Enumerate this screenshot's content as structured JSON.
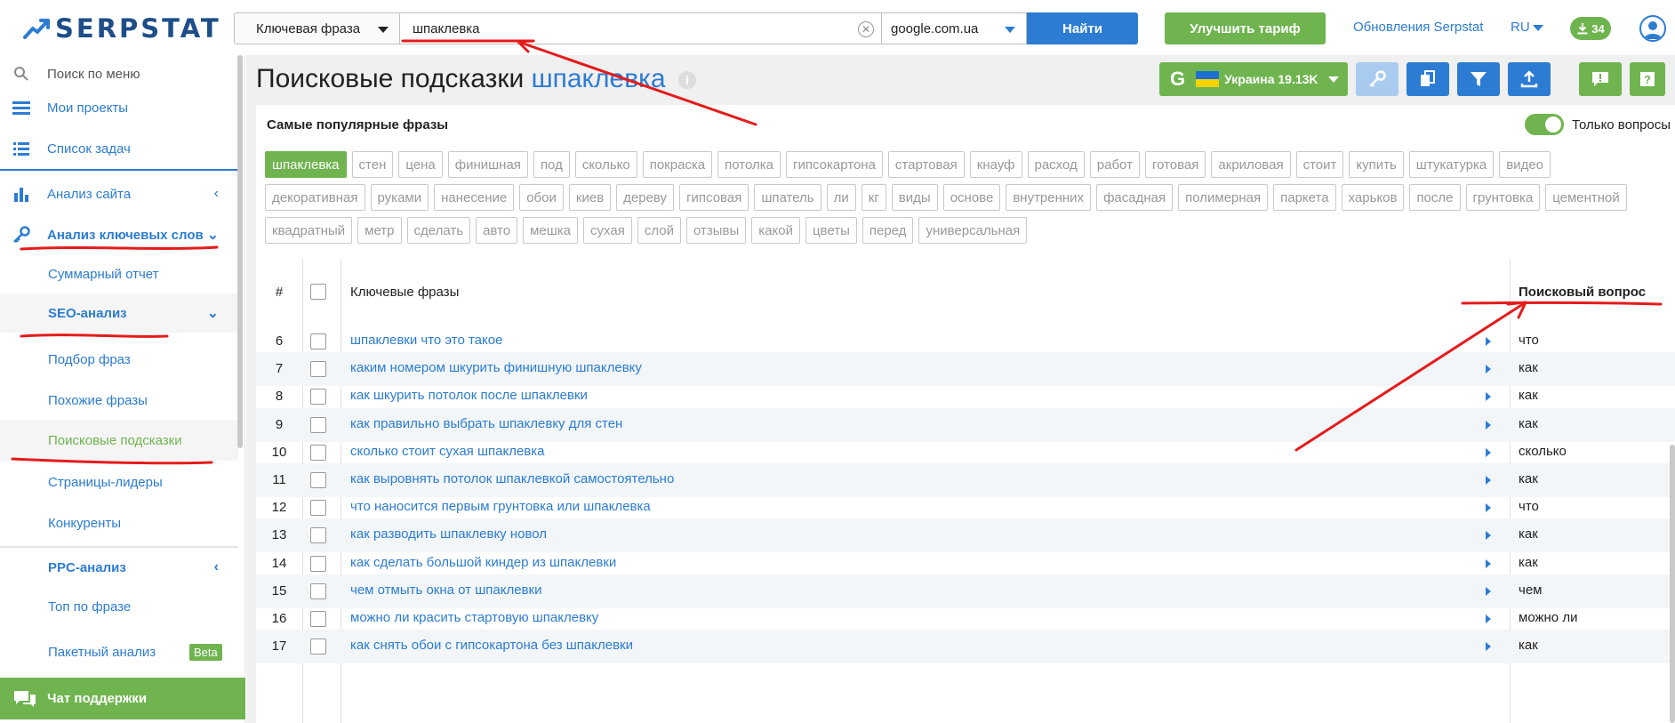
{
  "brand": {
    "name": "SERPSTAT"
  },
  "topbar": {
    "search_type": "Ключевая фраза",
    "search_value": "шпаклевка",
    "database": "google.com.ua",
    "find_label": "Найти",
    "upgrade_label": "Улучшить тариф",
    "updates_label": "Обновления Serpstat",
    "lang": "RU",
    "downloads_count": "34"
  },
  "sidebar": {
    "menu_search": "Поиск по меню",
    "my_projects": "Мои проекты",
    "task_list": "Список задач",
    "site_analysis": "Анализ сайта",
    "keyword_analysis": "Анализ ключевых слов",
    "summary_report": "Суммарный отчет",
    "seo_analysis": "SEO-анализ",
    "phrase_selection": "Подбор фраз",
    "similar_phrases": "Похожие фразы",
    "search_suggestions": "Поисковые подсказки",
    "leader_pages": "Страницы-лидеры",
    "competitors": "Конкуренты",
    "ppc_analysis": "PPC-анализ",
    "top_by_phrase": "Топ по фразе",
    "batch_analysis": "Пакетный анализ",
    "beta": "Beta",
    "support_chat": "Чат поддержки"
  },
  "page": {
    "title_prefix": "Поисковые подсказки",
    "title_keyword": "шпаклевка",
    "region_label": "Украина 19.13K"
  },
  "popular": {
    "title": "Самые популярные фразы",
    "only_questions": "Только вопросы",
    "tags": [
      "шпаклевка",
      "стен",
      "цена",
      "финишная",
      "под",
      "сколько",
      "покраска",
      "потолка",
      "гипсокартона",
      "стартовая",
      "кнауф",
      "расход",
      "работ",
      "готовая",
      "акриловая",
      "стоит",
      "купить",
      "штукатурка",
      "видео",
      "декоративная",
      "руками",
      "нанесение",
      "обои",
      "киев",
      "дереву",
      "гипсовая",
      "шпатель",
      "ли",
      "кг",
      "виды",
      "основе",
      "внутренних",
      "фасадная",
      "полимерная",
      "паркета",
      "харьков",
      "после",
      "грунтовка",
      "цементной",
      "квадратный",
      "метр",
      "сделать",
      "авто",
      "мешка",
      "сухая",
      "слой",
      "отзывы",
      "какой",
      "цветы",
      "перед",
      "универсальная"
    ]
  },
  "table": {
    "col_num": "#",
    "col_keywords": "Ключевые фразы",
    "col_question": "Поисковый вопрос",
    "rows": [
      {
        "n": "6",
        "kw": "шпаклевки что это такое",
        "q": "что"
      },
      {
        "n": "7",
        "kw": "каким номером шкурить финишную шпаклевку",
        "q": "как"
      },
      {
        "n": "8",
        "kw": "как шкурить потолок после шпаклевки",
        "q": "как"
      },
      {
        "n": "9",
        "kw": "как правильно выбрать шпаклевку для стен",
        "q": "как"
      },
      {
        "n": "10",
        "kw": "сколько стоит сухая шпаклевка",
        "q": "сколько"
      },
      {
        "n": "11",
        "kw": "как выровнять потолок шпаклевкой самостоятельно",
        "q": "как"
      },
      {
        "n": "12",
        "kw": "что наносится первым грунтовка или шпаклевка",
        "q": "что"
      },
      {
        "n": "13",
        "kw": "как разводить шпаклевку новол",
        "q": "как"
      },
      {
        "n": "14",
        "kw": "как сделать большой киндер из шпаклевки",
        "q": "как"
      },
      {
        "n": "15",
        "kw": "чем отмыть окна от шпаклевки",
        "q": "чем"
      },
      {
        "n": "16",
        "kw": "можно ли красить стартовую шпаклевку",
        "q": "можно ли"
      },
      {
        "n": "17",
        "kw": "как снять обои с гипсокартона без шпаклевки",
        "q": "как"
      }
    ]
  },
  "colors": {
    "brand_blue": "#2c7cd3",
    "brand_green": "#6fb44f",
    "annotation_red": "#e51b1b"
  }
}
